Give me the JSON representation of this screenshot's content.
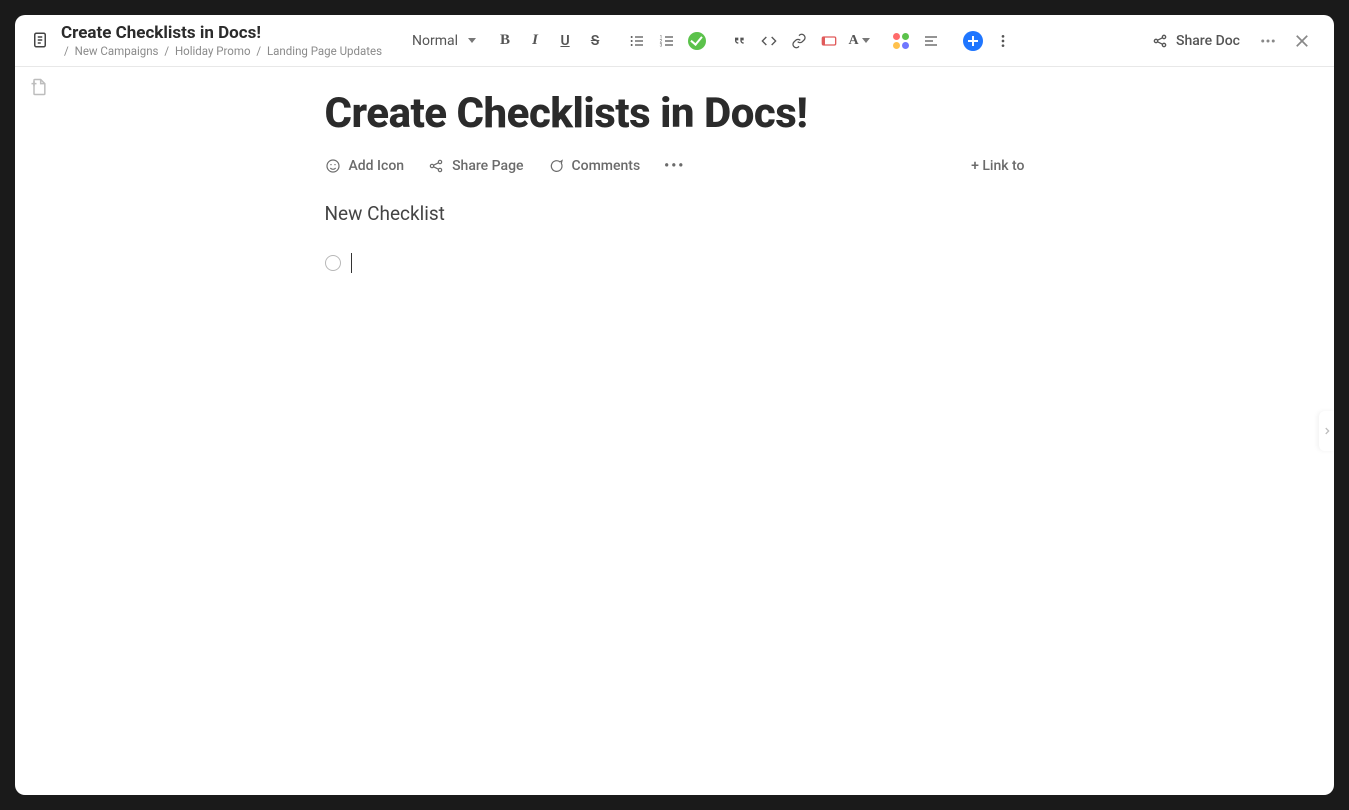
{
  "header": {
    "doc_title": "Create Checklists in Docs!",
    "breadcrumb": [
      "New Campaigns",
      "Holiday Promo",
      "Landing Page Updates"
    ],
    "style_label": "Normal",
    "share_label": "Share Doc"
  },
  "toolbar": {
    "bold": "B",
    "italic": "I",
    "underline": "U",
    "strike": "S",
    "quote_icon_title": "Quote",
    "code_icon_title": "Code",
    "link_icon_title": "Link",
    "banner_icon_title": "Banner",
    "text_color": "A"
  },
  "page": {
    "title": "Create Checklists in Docs!",
    "add_icon_label": "Add Icon",
    "share_page_label": "Share Page",
    "comments_label": "Comments",
    "link_to_label": "+ Link to",
    "section_heading": "New Checklist",
    "checklist": [
      {
        "checked": false,
        "text": ""
      }
    ]
  }
}
